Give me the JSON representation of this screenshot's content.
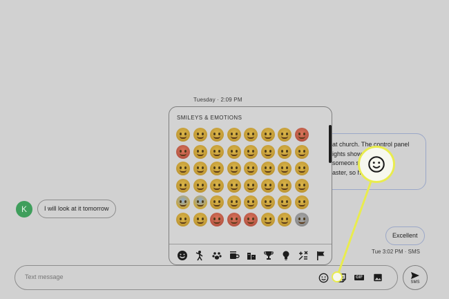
{
  "conversation": {
    "timestamp": "Tuesday · 2:09 PM",
    "received": {
      "avatar_initial": "K",
      "text": "I will look at it tomorrow"
    },
    "sent_partial_lines": [
      "at church. The control panel",
      "ights show    nics or",
      "someon      soon as",
      "aster, so h      peakers"
    ],
    "sent_excellent": "Excellent",
    "sent_meta": "Tue 3:02 PM · SMS"
  },
  "emoji_picker": {
    "section_title": "SMILEYS & EMOTIONS",
    "categories": [
      "smileys-icon",
      "people-icon",
      "animals-nature-icon",
      "food-drink-icon",
      "travel-places-icon",
      "activities-icon",
      "objects-icon",
      "symbols-icon",
      "flags-icon"
    ],
    "active_category": "smileys-icon",
    "rows": 6,
    "columns": 8
  },
  "composer": {
    "placeholder": "Text message",
    "send_label": "SMS",
    "gif_label": "GIF"
  },
  "colors": {
    "background": "#d1d1d1",
    "avatar": "#3f9e5c",
    "highlight": "#e9ec4e",
    "active_tab": "#2b5fc7"
  }
}
